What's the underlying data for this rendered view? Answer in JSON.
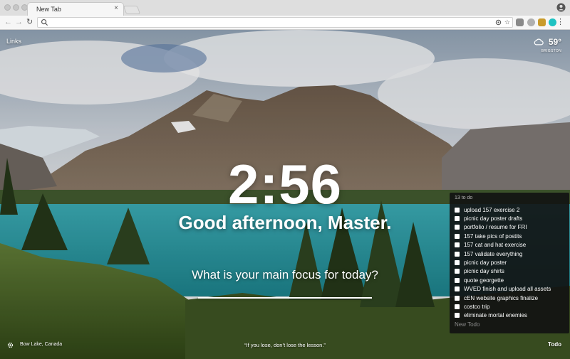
{
  "browser": {
    "tab_title": "New Tab",
    "tab_close": "×",
    "omnibox_value": ""
  },
  "dashboard": {
    "links_label": "Links",
    "weather": {
      "temperature": "59°",
      "location": "BRIGSTON"
    },
    "clock": "2:56",
    "greeting": "Good afternoon, Master.",
    "focus_question": "What is your main focus for today?",
    "location_caption": "Bow Lake, Canada",
    "quote": "“If you lose, don’t lose the lesson.”",
    "todo_button": "Todo"
  },
  "todo": {
    "count_label": "13 to do",
    "items": [
      "upload 157 exercise 2",
      "picnic day poster drafts",
      "portfolio / resume for FRI",
      "157 take pics of postits",
      "157 cat and hat exercise",
      "157 validate everything",
      "picnic day poster",
      "picnic day shirts",
      "quote georgette",
      "WVED finish and upload all assets",
      "cEN website graphics finalize",
      "costco trip",
      "eliminate mortal enemies"
    ],
    "new_placeholder": "New Todo"
  },
  "icons": {
    "back": "arrow-left",
    "forward": "arrow-right",
    "reload": "reload",
    "search": "magnifier",
    "bookmark": "star",
    "weather": "cloud",
    "settings": "gear"
  },
  "colors": {
    "extension_teal": "#1ec2c2",
    "extension_gold": "#c99b2b"
  }
}
